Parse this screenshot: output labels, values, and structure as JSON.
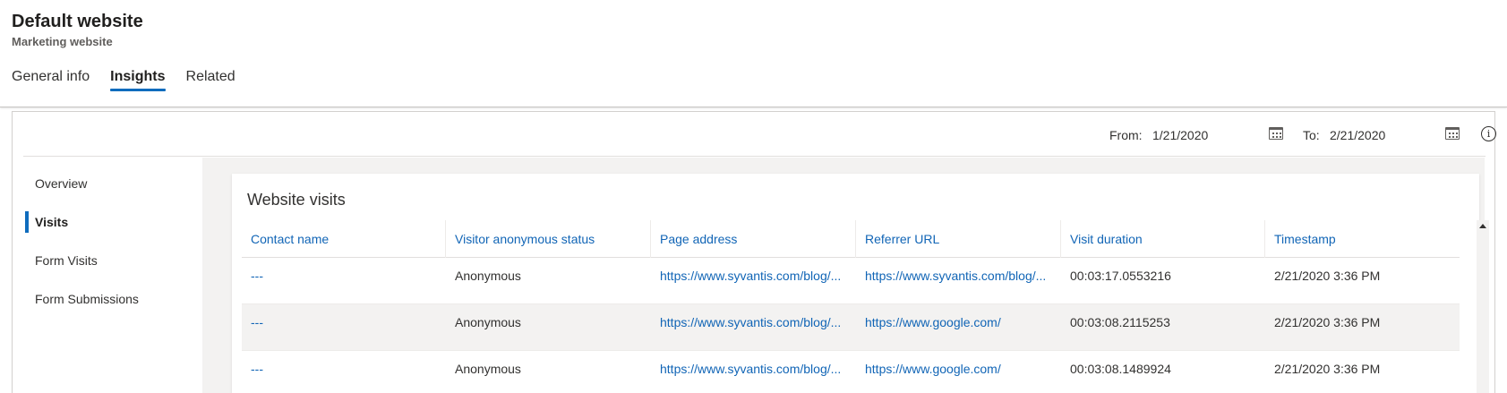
{
  "header": {
    "title": "Default website",
    "subtitle": "Marketing website",
    "tabs": [
      {
        "label": "General info",
        "active": false
      },
      {
        "label": "Insights",
        "active": true
      },
      {
        "label": "Related",
        "active": false
      }
    ]
  },
  "date_range": {
    "from_label": "From:",
    "from_value": "1/21/2020",
    "to_label": "To:",
    "to_value": "2/21/2020"
  },
  "sidenav": {
    "items": [
      {
        "label": "Overview"
      },
      {
        "label": "Visits",
        "active": true
      },
      {
        "label": "Form Visits"
      },
      {
        "label": "Form Submissions"
      }
    ]
  },
  "card": {
    "title": "Website visits",
    "columns": [
      "Contact name",
      "Visitor anonymous status",
      "Page address",
      "Referrer URL",
      "Visit duration",
      "Timestamp"
    ],
    "rows": [
      [
        "---",
        "Anonymous",
        "https://www.syvantis.com/blog/...",
        "https://www.syvantis.com/blog/...",
        "00:03:17.0553216",
        "2/21/2020 3:36 PM"
      ],
      [
        "---",
        "Anonymous",
        "https://www.syvantis.com/blog/...",
        "https://www.google.com/",
        "00:03:08.2115253",
        "2/21/2020 3:36 PM"
      ],
      [
        "---",
        "Anonymous",
        "https://www.syvantis.com/blog/...",
        "https://www.google.com/",
        "00:03:08.1489924",
        "2/21/2020 3:36 PM"
      ]
    ]
  },
  "icons": {
    "calendar": "calendar-icon",
    "info": "info-icon",
    "scroll_up": "chevron-up-icon"
  },
  "colors": {
    "accent": "#0f6cbd",
    "link": "#1165b6"
  }
}
